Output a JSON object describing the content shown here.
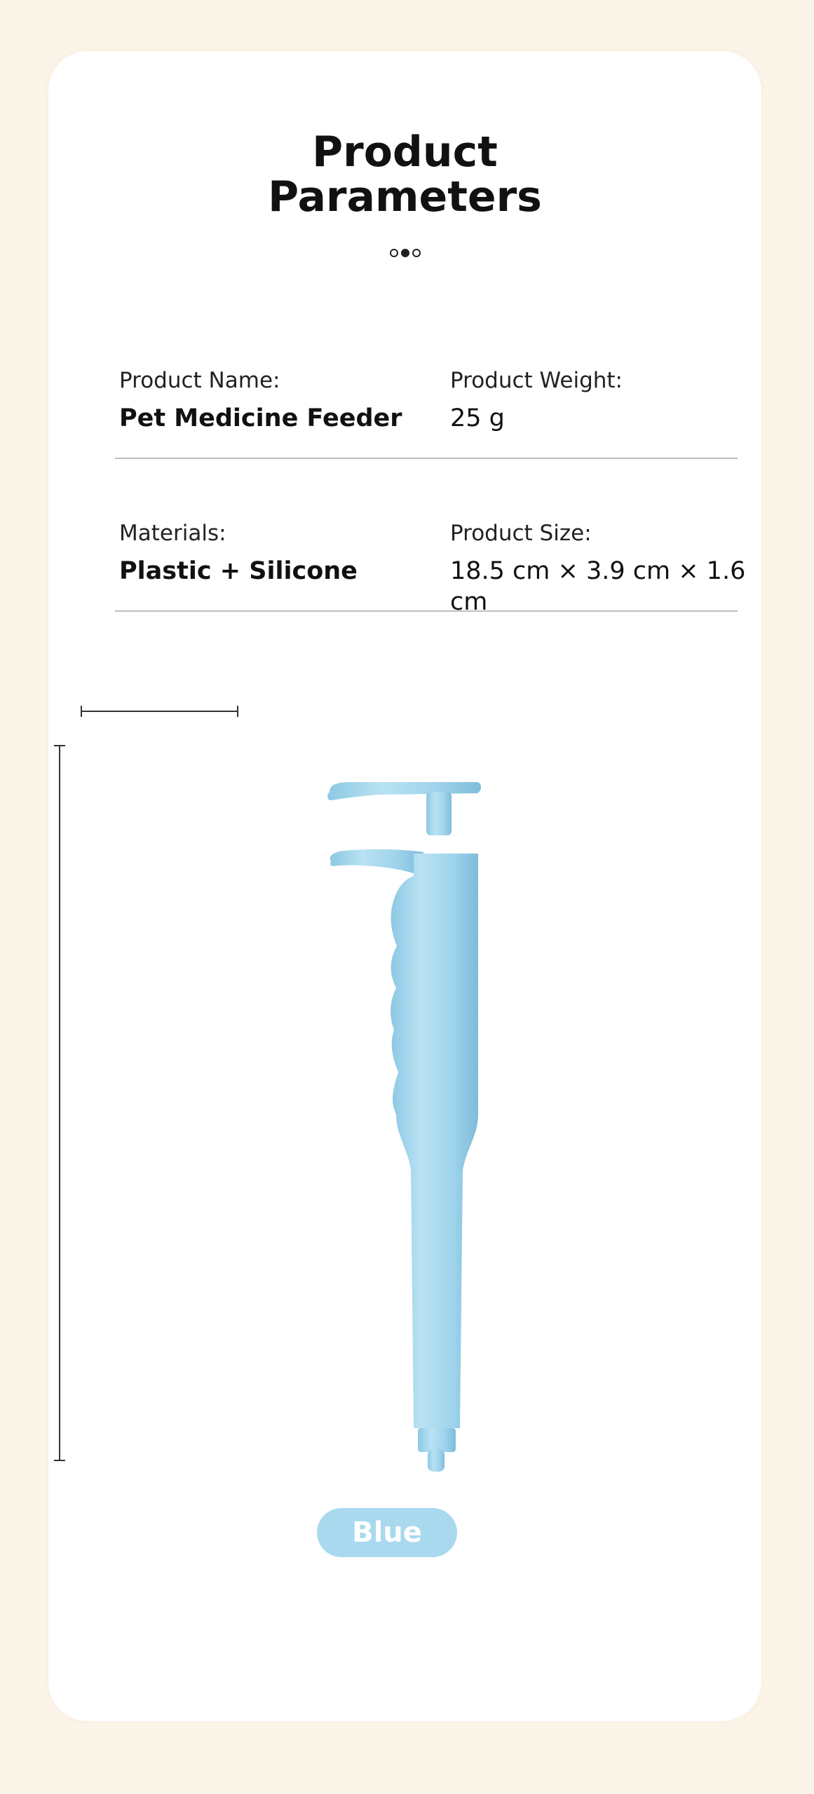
{
  "title_line1": "Product",
  "title_line2": "Parameters",
  "params": {
    "name_label": "Product Name:",
    "name_value": "Pet Medicine Feeder",
    "weight_label": "Product Weight:",
    "weight_value": "25 g",
    "materials_label": "Materials:",
    "materials_value": "Plastic + Silicone",
    "size_label": "Product Size:",
    "size_value": "18.5 cm × 3.9 cm × 1.6 cm"
  },
  "carousel": {
    "count": 3,
    "active_index": 1
  },
  "color_option": "Blue",
  "colors": {
    "background": "#fbf4e8",
    "card": "#ffffff",
    "product_blue": "#9fd4ec",
    "badge": "#a8d9ef"
  }
}
